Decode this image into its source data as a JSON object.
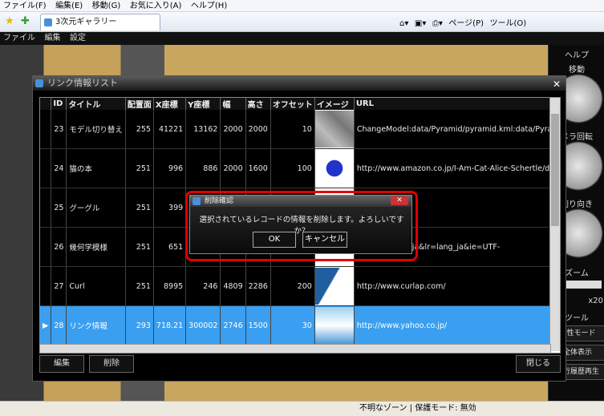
{
  "ie": {
    "menu": [
      "ファイル(F)",
      "編集(E)",
      "移動(G)",
      "お気に入り(A)",
      "ヘルプ(H)"
    ],
    "tab_title": "3次元ギャラリー",
    "toolbar_page": "ページ(P)",
    "toolbar_tools": "ツール(O)"
  },
  "app": {
    "menu": [
      "ファイル",
      "編集",
      "設定"
    ]
  },
  "right_panel": {
    "help": "ヘルプ",
    "move": "移動",
    "camera_rotate": "メラ回転",
    "direction": "剣り向き",
    "zoom": "ズーム",
    "zoom_value": "x20",
    "tools": "ツール",
    "btn1": "属性モード",
    "btn2": "全体表示",
    "btn3": "走行履歴再生"
  },
  "window": {
    "title": "リンク情報リスト",
    "columns": [
      "ID",
      "タイトル",
      "配置面",
      "X座標",
      "Y座標",
      "幅",
      "高さ",
      "オフセット",
      "イメージ",
      "URL"
    ],
    "rows": [
      {
        "id": "23",
        "title": "モデル切り替え",
        "face": "255",
        "x": "41221",
        "y": "13162",
        "w": "2000",
        "h": "2000",
        "offset": "10",
        "url": "ChangeModel:data/Pyramid/pyramid.kml:data/Pyramid/Lin"
      },
      {
        "id": "24",
        "title": "猫の本",
        "face": "251",
        "x": "996",
        "y": "886",
        "w": "2000",
        "h": "1600",
        "offset": "100",
        "url": "http://www.amazon.co.jp/I-Am-Cat-Alice-Schertle/dp/0688"
      },
      {
        "id": "25",
        "title": "グーグル",
        "face": "251",
        "x": "399",
        "y": "",
        "w": "",
        "h": "",
        "offset": "",
        "url": ".co.jp/"
      },
      {
        "id": "26",
        "title": "幾何学模様",
        "face": "251",
        "x": "651",
        "y": "",
        "w": "",
        "h": "",
        "offset": "",
        "url": "/m/search?hl=ja&lr=lang_ja&ie=UTF-"
      },
      {
        "id": "27",
        "title": "Curl",
        "face": "251",
        "x": "8995",
        "y": "246",
        "w": "4809",
        "h": "2286",
        "offset": "200",
        "url": "http://www.curlap.com/"
      },
      {
        "id": "28",
        "title": "リンク情報",
        "face": "293",
        "x": "718.21",
        "y": "300002",
        "w": "2746",
        "h": "1500",
        "offset": "30",
        "url": "http://www.yahoo.co.jp/"
      }
    ],
    "btn_edit": "編集",
    "btn_delete": "削除",
    "btn_close": "閉じる"
  },
  "dialog": {
    "title": "削除確認",
    "message": "選択されているレコードの情報を削除します。よろしいですか？",
    "ok": "OK",
    "cancel": "キャンセル"
  },
  "status": {
    "zone": "不明なゾーン | 保護モード: 無効"
  },
  "colors": {
    "selected_row": "#3a9ff0",
    "highlight": "#e00000"
  }
}
